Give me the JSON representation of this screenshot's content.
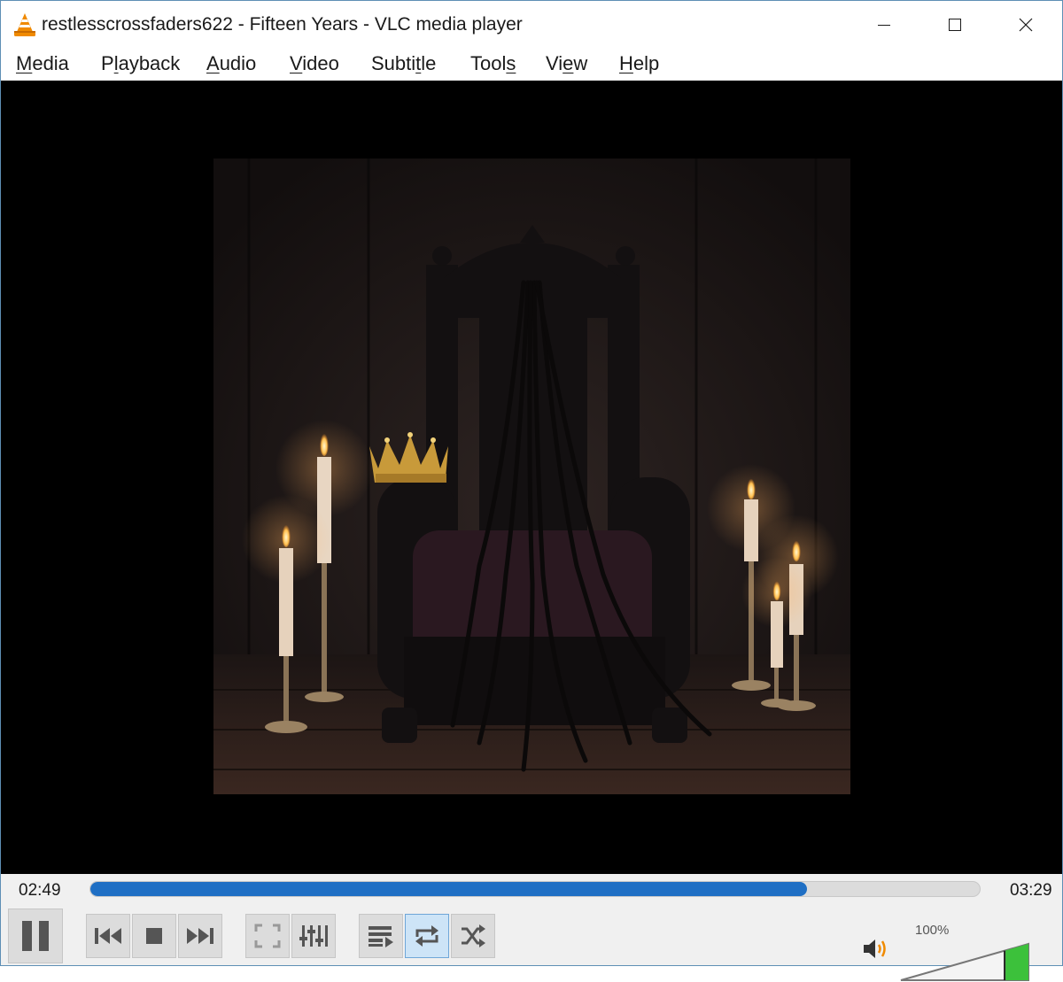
{
  "window": {
    "title": "restlesscrossfaders622 - Fifteen Years - VLC media player"
  },
  "menu": {
    "items": [
      {
        "pre": "",
        "key": "M",
        "post": "edia"
      },
      {
        "pre": "P",
        "key": "l",
        "post": "ayback"
      },
      {
        "pre": "",
        "key": "A",
        "post": "udio"
      },
      {
        "pre": "",
        "key": "V",
        "post": "ideo"
      },
      {
        "pre": "Subti",
        "key": "t",
        "post": "le"
      },
      {
        "pre": "Tool",
        "key": "s",
        "post": ""
      },
      {
        "pre": "Vi",
        "key": "e",
        "post": "w"
      },
      {
        "pre": "",
        "key": "H",
        "post": "elp"
      }
    ]
  },
  "player": {
    "elapsed": "02:49",
    "total": "03:29",
    "progress_fraction": 0.806,
    "volume_label": "100%",
    "volume_fraction": 1.0
  },
  "controls": {
    "icons": [
      "pause-icon",
      "previous-icon",
      "stop-icon",
      "next-icon",
      "fullscreen-icon",
      "extended-settings-icon",
      "playlist-icon",
      "loop-icon",
      "shuffle-icon",
      "volume-speaker-icon"
    ],
    "loop_active": true
  },
  "colors": {
    "progress": "#1f6fc4",
    "volume": "#3cc13b",
    "vlc_orange": "#f08a00",
    "video_bg": "#000000"
  }
}
